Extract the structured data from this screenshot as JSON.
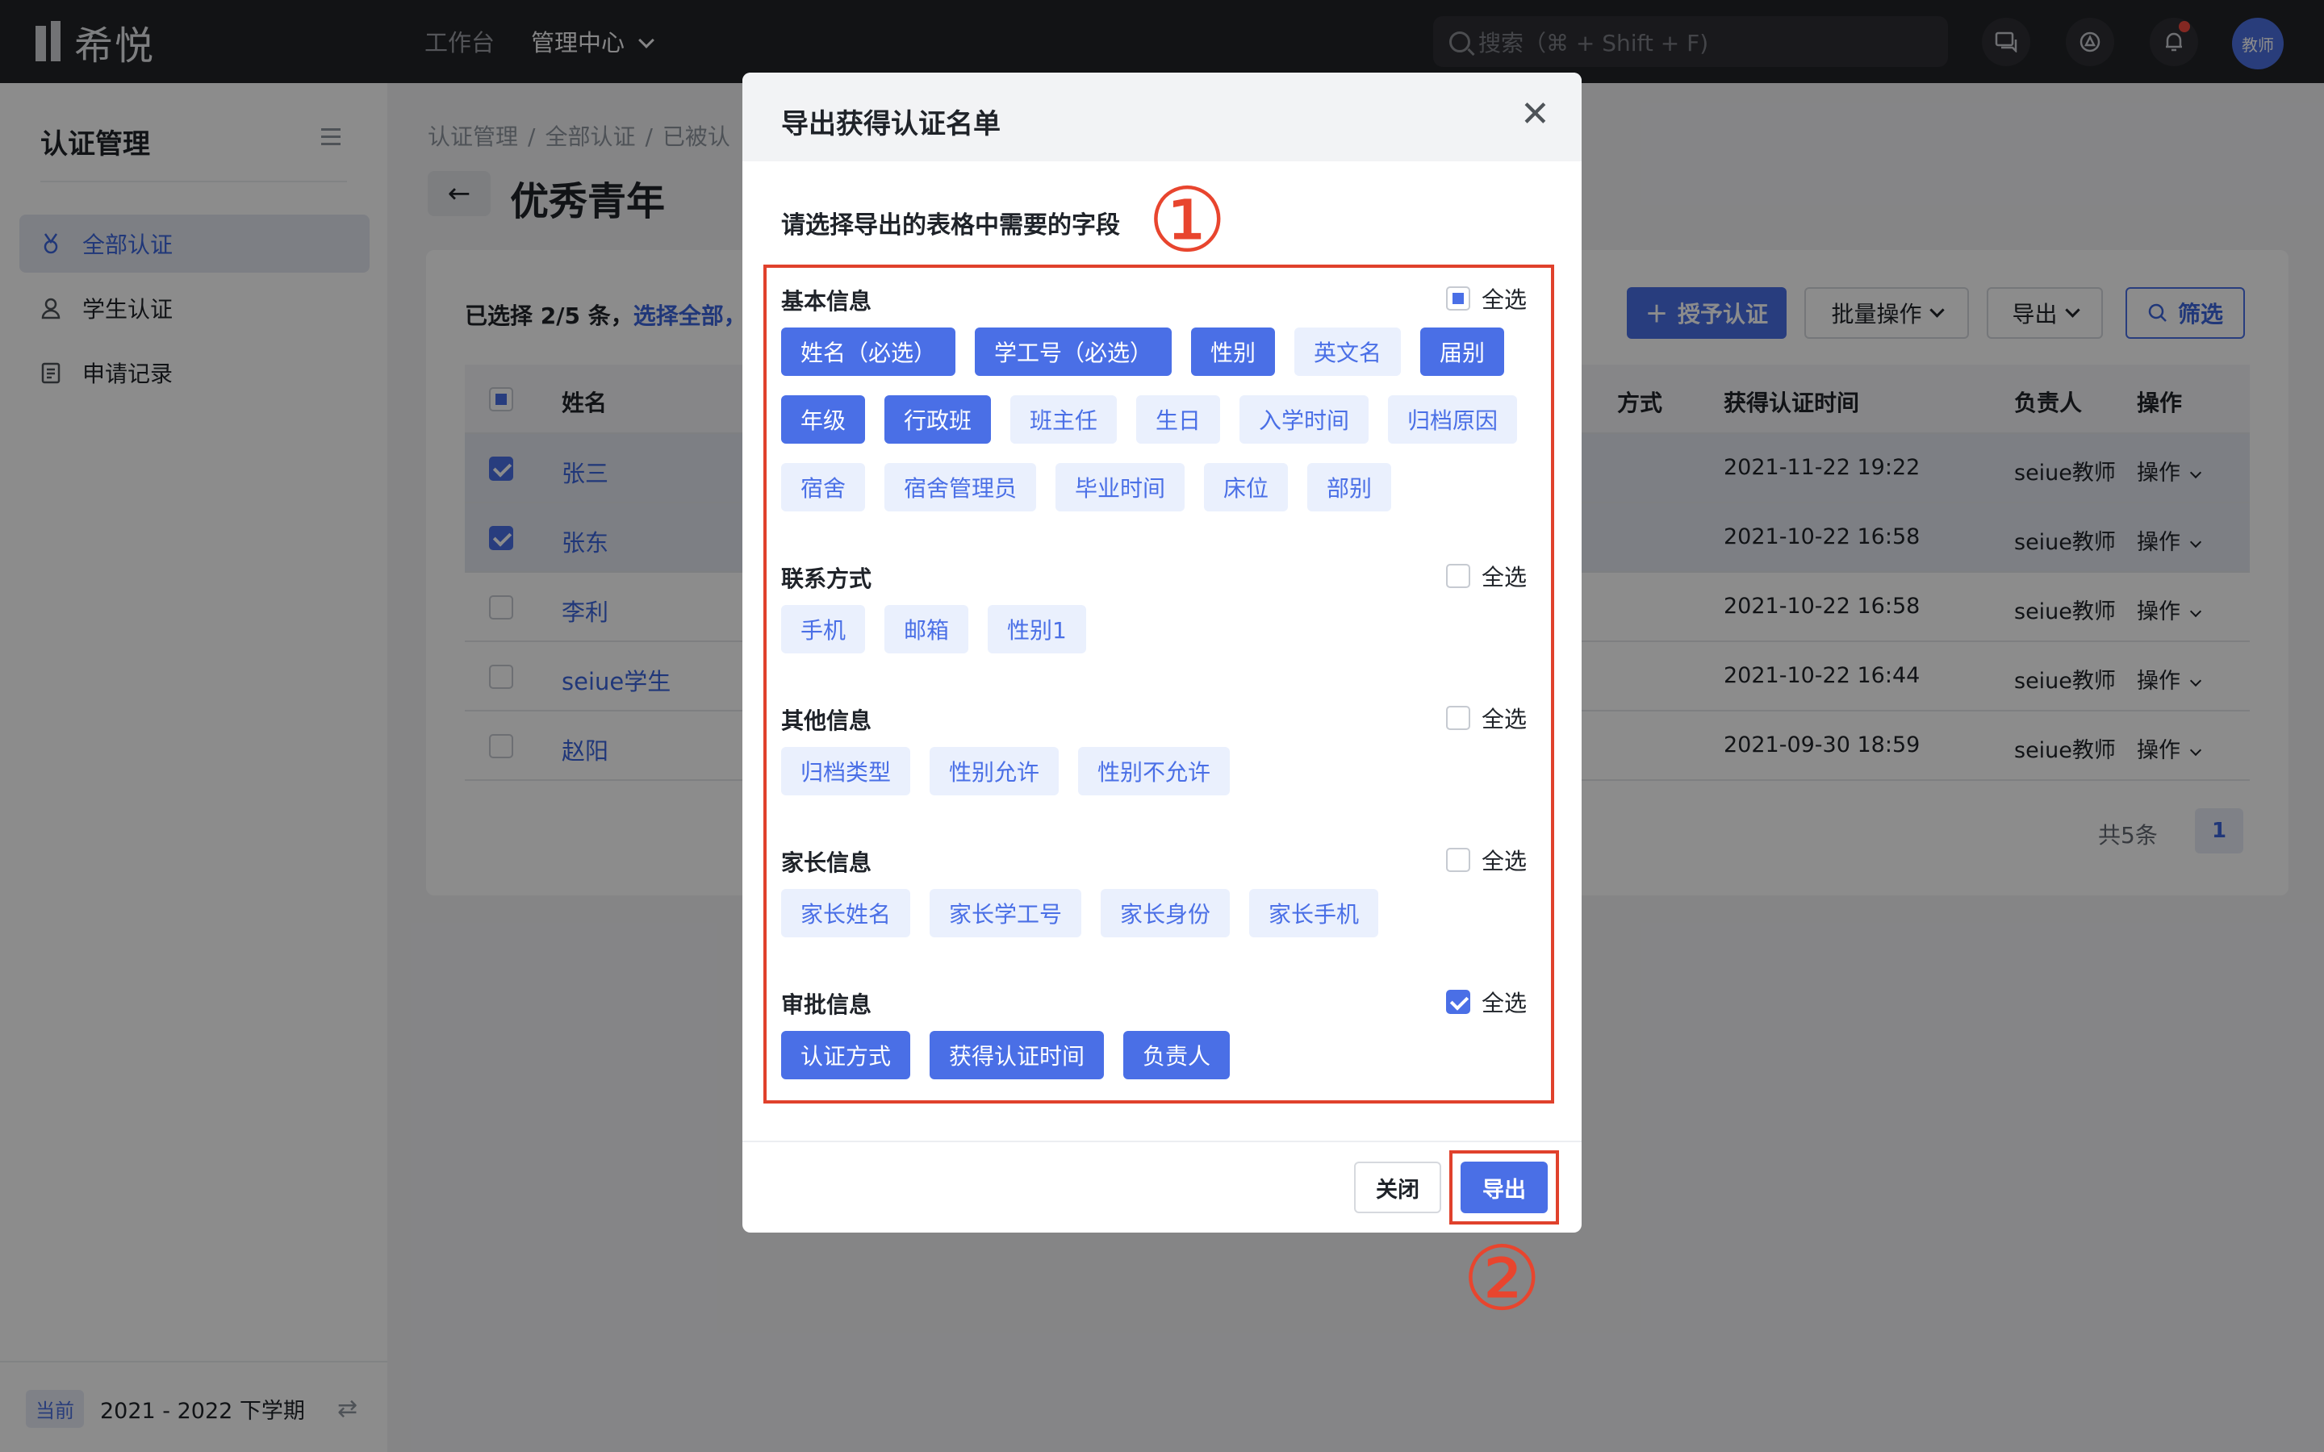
{
  "topbar": {
    "logo": "希悦",
    "nav": [
      "工作台",
      "管理中心"
    ],
    "search_placeholder": "搜索（⌘ + Shift + F)",
    "avatar": "教师",
    "notification_dot_color": "#f04a3e"
  },
  "sidebar": {
    "title": "认证管理",
    "items": [
      {
        "label": "全部认证",
        "icon": "medal-icon",
        "active": true
      },
      {
        "label": "学生认证",
        "icon": "user-icon",
        "active": false
      },
      {
        "label": "申请记录",
        "icon": "document-icon",
        "active": false
      }
    ],
    "term_tag": "当前",
    "term": "2021 - 2022 下学期"
  },
  "main": {
    "breadcrumb": [
      "认证管理",
      "全部认证",
      "已被认"
    ],
    "title": "优秀青年",
    "selection": {
      "text": "已选择 2/5 条，",
      "link": "选择全部，"
    },
    "toolbar": {
      "grant": "授予认证",
      "batch": "批量操作",
      "export": "导出",
      "filter": "筛选"
    },
    "columns": [
      "姓名",
      "方式",
      "获得认证时间",
      "负责人",
      "操作"
    ],
    "rows": [
      {
        "name": "张三",
        "time": "2021-11-22 19:22",
        "owner": "seiue教师",
        "op": "操作",
        "checked": true
      },
      {
        "name": "张东",
        "time": "2021-10-22 16:58",
        "owner": "seiue教师",
        "op": "操作",
        "checked": true
      },
      {
        "name": "李利",
        "time": "2021-10-22 16:58",
        "owner": "seiue教师",
        "op": "操作",
        "checked": false
      },
      {
        "name": "seiue学生",
        "time": "2021-10-22 16:44",
        "owner": "seiue教师",
        "op": "操作",
        "checked": false
      },
      {
        "name": "赵阳",
        "time": "2021-09-30 18:59",
        "owner": "seiue教师",
        "op": "操作",
        "checked": false
      }
    ],
    "pager": {
      "total": "共5条",
      "page": "1"
    }
  },
  "modal": {
    "title": "导出获得认证名单",
    "subtitle": "请选择导出的表格中需要的字段",
    "marker1": "①",
    "marker2": "②",
    "select_all": "全选",
    "sections": [
      {
        "title": "基本信息",
        "state": "partial",
        "tags": [
          {
            "label": "姓名（必选）",
            "on": true
          },
          {
            "label": "学工号（必选）",
            "on": true
          },
          {
            "label": "性别",
            "on": true
          },
          {
            "label": "英文名",
            "on": false
          },
          {
            "label": "届别",
            "on": true
          },
          {
            "label": "年级",
            "on": true
          },
          {
            "label": "行政班",
            "on": true
          },
          {
            "label": "班主任",
            "on": false
          },
          {
            "label": "生日",
            "on": false
          },
          {
            "label": "入学时间",
            "on": false
          },
          {
            "label": "归档原因",
            "on": false
          },
          {
            "label": "宿舍",
            "on": false
          },
          {
            "label": "宿舍管理员",
            "on": false
          },
          {
            "label": "毕业时间",
            "on": false
          },
          {
            "label": "床位",
            "on": false
          },
          {
            "label": "部别",
            "on": false
          }
        ]
      },
      {
        "title": "联系方式",
        "state": "unchecked",
        "tags": [
          {
            "label": "手机",
            "on": false
          },
          {
            "label": "邮箱",
            "on": false
          },
          {
            "label": "性别1",
            "on": false
          }
        ]
      },
      {
        "title": "其他信息",
        "state": "unchecked",
        "tags": [
          {
            "label": "归档类型",
            "on": false
          },
          {
            "label": "性别允许",
            "on": false
          },
          {
            "label": "性别不允许",
            "on": false
          }
        ]
      },
      {
        "title": "家长信息",
        "state": "unchecked",
        "tags": [
          {
            "label": "家长姓名",
            "on": false
          },
          {
            "label": "家长学工号",
            "on": false
          },
          {
            "label": "家长身份",
            "on": false
          },
          {
            "label": "家长手机",
            "on": false
          }
        ]
      },
      {
        "title": "审批信息",
        "state": "checked",
        "tags": [
          {
            "label": "认证方式",
            "on": true
          },
          {
            "label": "获得认证时间",
            "on": true
          },
          {
            "label": "负责人",
            "on": true
          }
        ]
      }
    ],
    "close_label": "关闭",
    "export_label": "导出"
  },
  "colors": {
    "accent": "#4a6fe6",
    "annotation": "#e0412c",
    "topbar": "#222327"
  }
}
